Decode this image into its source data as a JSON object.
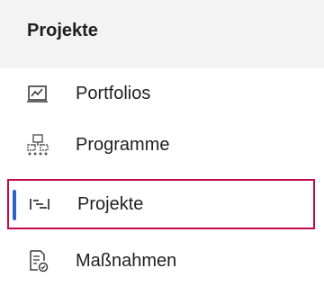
{
  "section": {
    "title": "Projekte"
  },
  "nav": {
    "items": [
      {
        "label": "Portfolios",
        "icon": "portfolio-chart-icon"
      },
      {
        "label": "Programme",
        "icon": "program-network-icon"
      },
      {
        "label": "Projekte",
        "icon": "project-timeline-icon",
        "selected": true
      },
      {
        "label": "Maßnahmen",
        "icon": "measure-document-icon"
      }
    ]
  },
  "colors": {
    "selection_border": "#c20b4b",
    "selection_indicator": "#2b64c8",
    "header_background": "#f3f3f3",
    "text": "#1f1f1f"
  }
}
